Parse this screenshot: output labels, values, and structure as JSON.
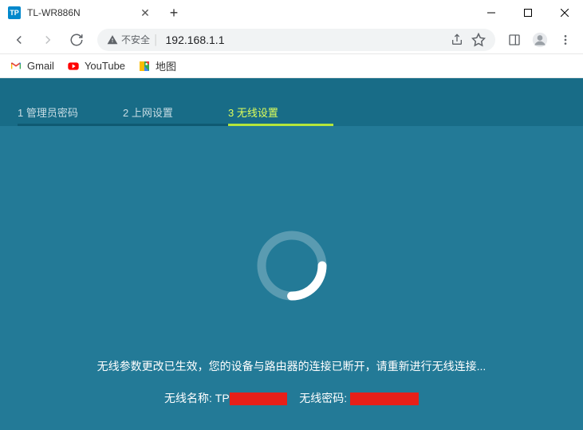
{
  "window": {
    "tab_title": "TL-WR886N",
    "tab_favicon_text": "TP"
  },
  "address": {
    "security_label": "不安全",
    "url": "192.168.1.1"
  },
  "bookmarks": [
    {
      "label": "Gmail",
      "icon": "gmail"
    },
    {
      "label": "YouTube",
      "icon": "youtube"
    },
    {
      "label": "地图",
      "icon": "maps"
    }
  ],
  "steps": [
    {
      "num": "1",
      "label": "管理员密码",
      "active": false
    },
    {
      "num": "2",
      "label": "上网设置",
      "active": false
    },
    {
      "num": "3",
      "label": "无线设置",
      "active": true
    }
  ],
  "page": {
    "status_message": "无线参数更改已生效，您的设备与路由器的连接已断开，请重新进行无线连接...",
    "ssid_label": "无线名称:",
    "ssid_prefix": "TP",
    "pwd_label": "无线密码:"
  }
}
